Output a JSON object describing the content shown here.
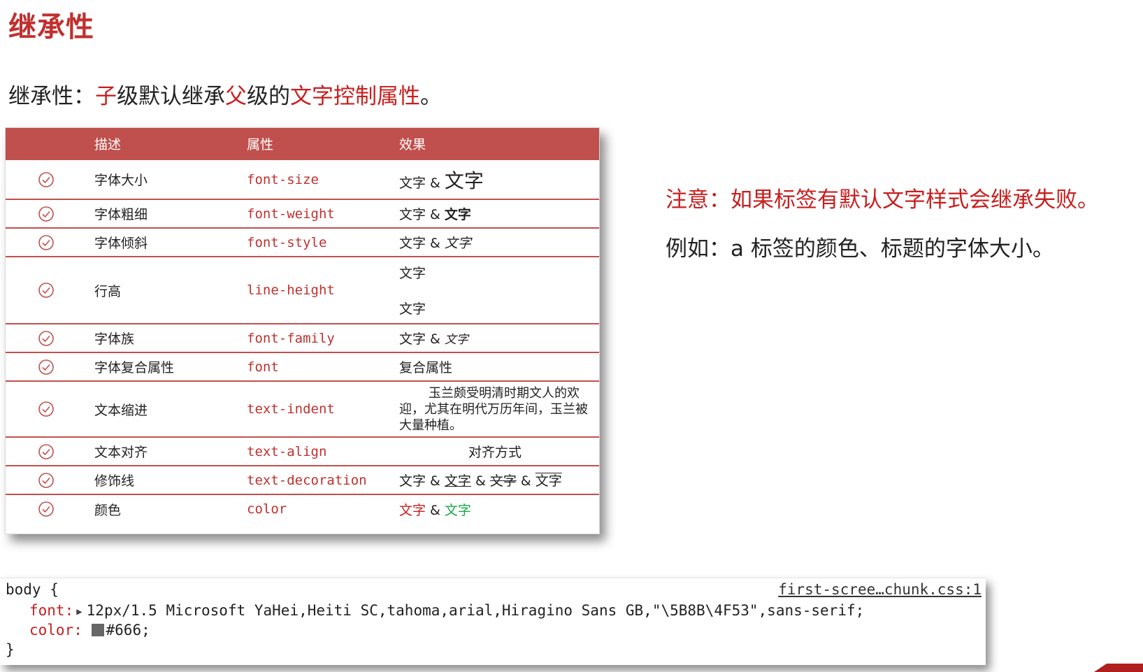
{
  "title": "继承性",
  "intro": {
    "p1": "继承性：",
    "p2": "子",
    "p3": "级默认继承",
    "p4": "父",
    "p5": "级的",
    "p6": "文字控制属性",
    "p7": "。"
  },
  "table": {
    "headers": [
      "",
      "描述",
      "属性",
      "效果"
    ],
    "rows": [
      {
        "desc": "字体大小",
        "prop": "font-size",
        "ex": [
          "文字 & ",
          "文字"
        ]
      },
      {
        "desc": "字体粗细",
        "prop": "font-weight",
        "ex": [
          "文字 & ",
          "文字"
        ]
      },
      {
        "desc": "字体倾斜",
        "prop": "font-style",
        "ex": [
          "文字 & ",
          "文字"
        ]
      },
      {
        "desc": "行高",
        "prop": "line-height",
        "ex": [
          "文字",
          "文字"
        ]
      },
      {
        "desc": "字体族",
        "prop": "font-family",
        "ex": [
          "文字 & ",
          "文字"
        ]
      },
      {
        "desc": "字体复合属性",
        "prop": "font",
        "ex": [
          "复合属性"
        ]
      },
      {
        "desc": "文本缩进",
        "prop": "text-indent",
        "ex": [
          "玉兰颇受明清时期文人的欢迎，尤其在明代万历年间，玉兰被大量种植。"
        ]
      },
      {
        "desc": "文本对齐",
        "prop": "text-align",
        "ex": [
          "对齐方式"
        ]
      },
      {
        "desc": "修饰线",
        "prop": "text-decoration",
        "ex": [
          "文字",
          " & ",
          "文字",
          " & ",
          "文字",
          " & ",
          "文字"
        ]
      },
      {
        "desc": "颜色",
        "prop": "color",
        "ex": [
          "文字",
          " & ",
          "文字"
        ]
      }
    ]
  },
  "note": "注意：如果标签有默认文字样式会继承失败。",
  "example": "例如：a 标签的颜色、标题的字体大小。",
  "code": {
    "selector": "body {",
    "source": "first-scree…chunk.css:1",
    "font_prop": "font:",
    "font_value": "12px/1.5 Microsoft YaHei,Heiti SC,tahoma,arial,Hiragino Sans GB,\"\\5B8B\\4F53\",sans-serif;",
    "color_prop": "color:",
    "color_value": "#666;",
    "close": "}"
  },
  "colors": {
    "accent": "#c0504d",
    "title_red": "#c0302e",
    "text_red": "#c81e1e",
    "green": "#1aa84a",
    "swatch": "#666666"
  },
  "icons": {
    "check": "check-circle-icon",
    "expand": "triangle-right-icon"
  }
}
